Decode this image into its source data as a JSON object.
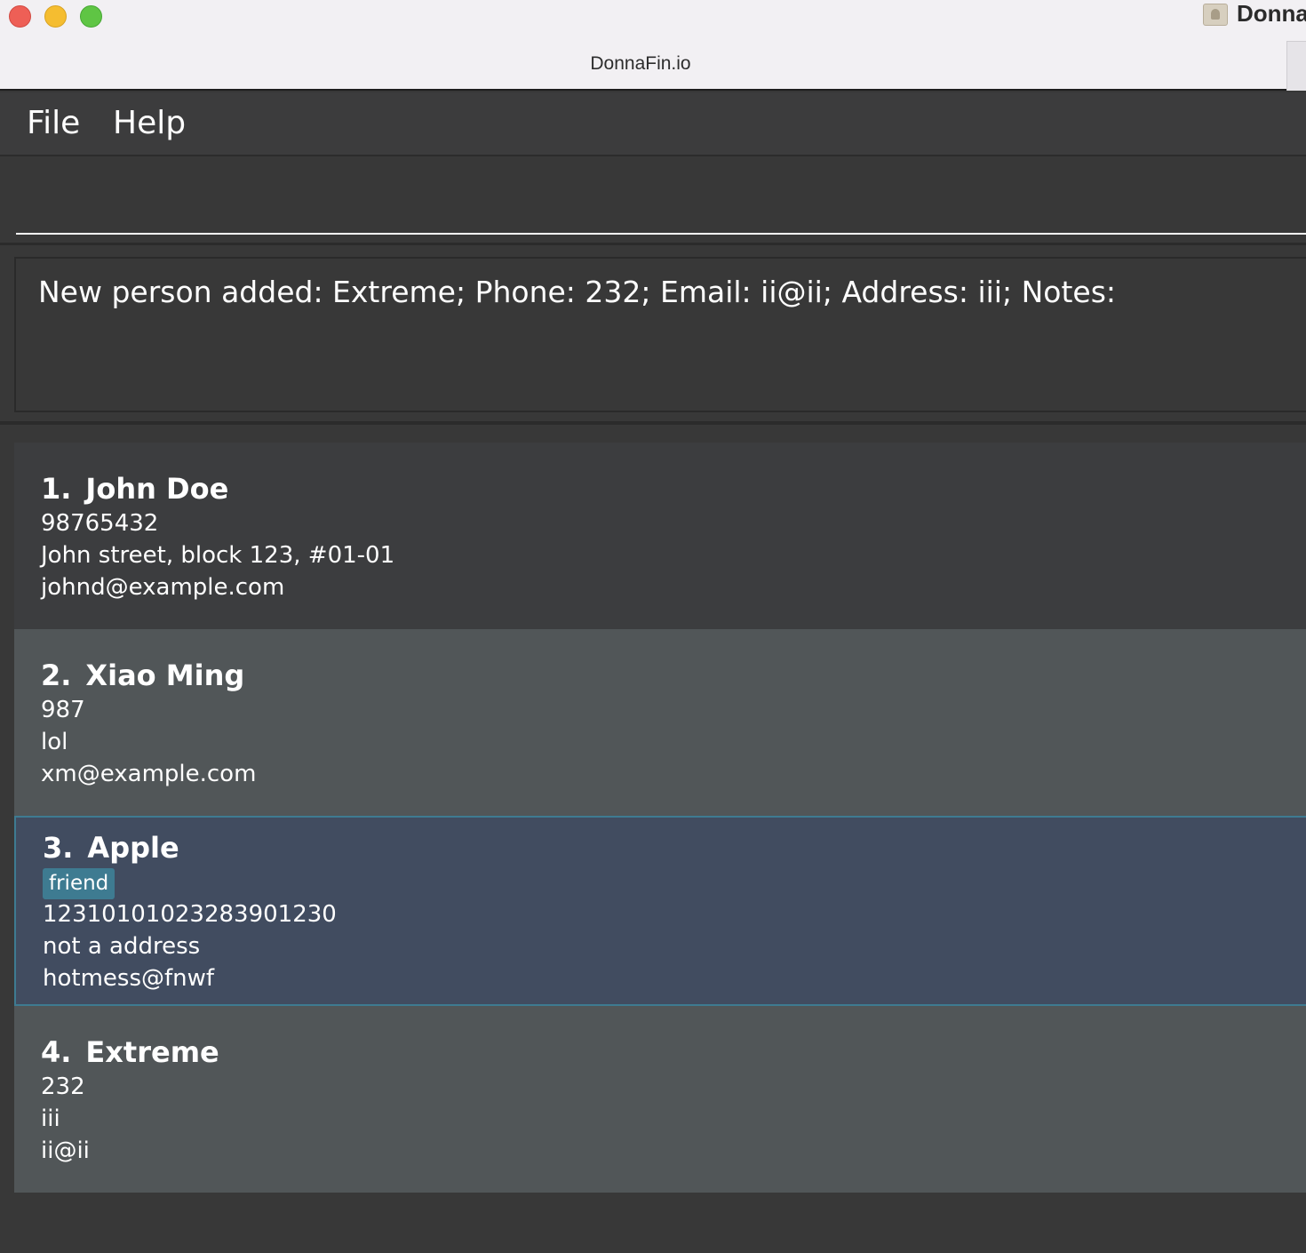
{
  "window": {
    "title": "DonnaFin.io",
    "app_label": "Donna"
  },
  "menu": {
    "file": "File",
    "help": "Help"
  },
  "command": {
    "value": "",
    "placeholder": ""
  },
  "result": {
    "text": "New person added: Extreme; Phone: 232; Email: ii@ii; Address: iii; Notes:"
  },
  "persons": [
    {
      "index": "1.",
      "name": "John Doe",
      "phone": "98765432",
      "address": "John street, block 123, #01-01",
      "email": "johnd@example.com",
      "tags": []
    },
    {
      "index": "2.",
      "name": "Xiao Ming",
      "phone": "987",
      "address": "lol",
      "email": "xm@example.com",
      "tags": []
    },
    {
      "index": "3.",
      "name": "Apple",
      "phone": "1231010102328390123​0",
      "address": "not a address",
      "email": "hotmess@fnwf",
      "tags": [
        "friend"
      ]
    },
    {
      "index": "4.",
      "name": "Extreme",
      "phone": "232",
      "address": "iii",
      "email": "ii@ii",
      "tags": []
    }
  ],
  "colors": {
    "background": "#383838",
    "card_dark": "#3c3d3f",
    "card_light": "#515658",
    "card_selected": "#414c60",
    "accent": "#3e7b91"
  },
  "icons": {
    "close": "traffic-light-close",
    "minimize": "traffic-light-minimize",
    "zoom": "traffic-light-zoom",
    "app": "contacts-app-icon"
  }
}
